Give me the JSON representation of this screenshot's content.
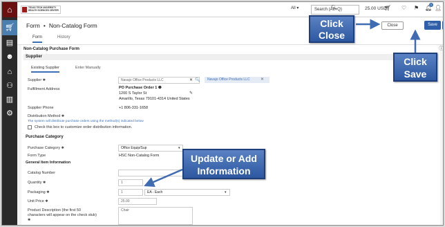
{
  "sidebar": {
    "items": [
      {
        "icon": "home-icon"
      },
      {
        "icon": "cart-icon"
      },
      {
        "icon": "document-icon"
      },
      {
        "icon": "user-icon"
      },
      {
        "icon": "bank-icon"
      },
      {
        "icon": "network-icon"
      },
      {
        "icon": "chart-icon"
      },
      {
        "icon": "gear-icon"
      }
    ]
  },
  "topbar": {
    "logo_line1": "TEXAS TECH UNIVERSITY",
    "logo_line2": "HEALTH SCIENCES CENTER",
    "search_scope": "All",
    "search_placeholder": "Search (Alt+Q)",
    "cart_total": "25.00 USD",
    "notification_count": "1"
  },
  "header": {
    "breadcrumb_form": "Form",
    "breadcrumb_sep": "•",
    "breadcrumb_page": "Non-Catalog Form",
    "tab_form": "Form",
    "tab_history": "History",
    "close_label": "Close",
    "save_label": "Save"
  },
  "form": {
    "title": "Non-Catalog Purchase Form",
    "supplier_section": "Supplier",
    "tab_existing": "Existing Supplier",
    "tab_manual": "Enter Manually",
    "supplier_label": "Supplier",
    "supplier_value": "Navajo Office Products LLC",
    "supplier_chip": "Navajo Office Products LLC",
    "fulfillment_label": "Fulfillment Address",
    "fulfillment_name": "PO Purchase Order 1",
    "fulfillment_street": "1200 S Taylor St",
    "fulfillment_city": "Amarillo, Texas 79101-4314 United States",
    "phone_label": "Supplier Phone",
    "phone_value": "+1 806-331-1658",
    "dist_label": "Distribution Method",
    "dist_note": "The system will distribute purchase orders using the method(s) indicated below",
    "dist_checkbox_label": "Check this box to customize order distribution information.",
    "purchase_category_section": "Purchase Category",
    "purchase_category_label": "Purchase Category",
    "purchase_category_value": "Office Equip/Sup",
    "form_type_label": "Form Type",
    "form_type_value": "HSC Non-Catalog Form",
    "general_section": "General Item Information",
    "catalog_label": "Catalog Number",
    "quantity_label": "Quantity",
    "quantity_value": "1",
    "packaging_label": "Packaging",
    "packaging_qty": "1",
    "packaging_unit": "EA - Each",
    "unit_price_label": "Unit Price",
    "unit_price_value": "25.00",
    "product_desc_label_1": "Product Description (the first 50",
    "product_desc_label_2": "characters will appear on the check stub)",
    "product_desc_value": "Chair"
  },
  "callouts": {
    "close_line1": "Click",
    "close_line2": "Close",
    "save_line1": "Click",
    "save_line2": "Save",
    "update_line1": "Update or Add",
    "update_line2": "Information"
  },
  "colors": {
    "primary_blue": "#2e5fa8",
    "callout_blue": "#3f6bb3",
    "brand_red": "#6a1010",
    "sidebar_dark": "#2b2b2b"
  }
}
